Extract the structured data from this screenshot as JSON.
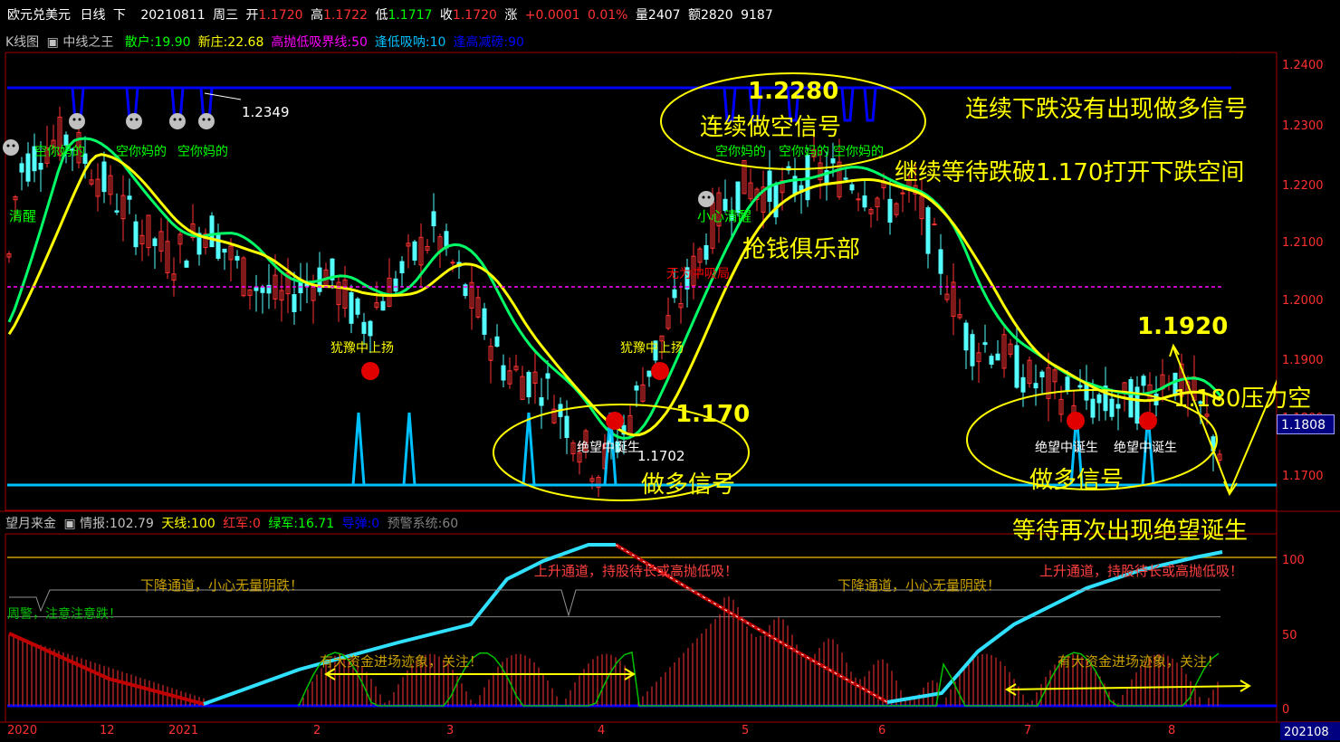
{
  "header": {
    "symbol": "欧元兑美元",
    "period": "日线",
    "dir": "下",
    "date": "20210811",
    "weekday": "周三",
    "open_label": "开",
    "open": "1.1720",
    "high_label": "高",
    "high": "1.1722",
    "low_label": "低",
    "low": "1.1717",
    "close_label": "收",
    "close": "1.1720",
    "change_label": "涨",
    "change": "+0.0001",
    "change_pct": "0.01%",
    "volume_label": "量",
    "volume": "2407",
    "amount_label": "额",
    "amount": "2820",
    "extra": "9187"
  },
  "main_panel": {
    "tab": "K线图",
    "indicator": "中线之王",
    "params": [
      {
        "label": "散户:",
        "value": "19.90",
        "color": "#00ff00"
      },
      {
        "label": "新庄:",
        "value": "22.68",
        "color": "#ffff00"
      },
      {
        "label": "高抛低吸界线:",
        "value": "50",
        "color": "#ff00ff"
      },
      {
        "label": "逢低吸呐:",
        "value": "10",
        "color": "#00c0ff"
      },
      {
        "label": "逢高减磅:",
        "value": "90",
        "color": "#0000ff"
      }
    ]
  },
  "price_axis": {
    "ticks": [
      "1.2400",
      "1.2300",
      "1.2200",
      "1.2100",
      "1.2000",
      "1.1900",
      "1.1800",
      "1.1700"
    ],
    "current": "1.1808"
  },
  "chart_labels": {
    "peak_value": "1.2349",
    "low_value": "1.1702",
    "kong_signal": "空你妈的",
    "qingxing": "清醒",
    "xiaoxin": "小心清醒",
    "wuwei": "无为中吸局",
    "youyu1": "犹豫中上扬",
    "youyu2": "犹豫中上扬",
    "juewang1": "绝望中诞生",
    "juewang2": "绝望中诞生",
    "juewang3": "绝望中诞生"
  },
  "annotations": {
    "peak_price": "1.2280",
    "peak_text": "连续做空信号",
    "top_right": "连续下跌没有出现做多信号",
    "wait_break": "继续等待跌破1.170打开下跌空间",
    "club": "抢钱俱乐部",
    "price_1170": "1.170",
    "long_signal_1": "做多信号",
    "price_1192": "1.1920",
    "pressure": "1.180压力空",
    "long_signal_2": "做多信号",
    "wait_again": "等待再次出现绝望诞生"
  },
  "sub_panel": {
    "name": "望月来金",
    "info_label": "情报:",
    "info": "102.79",
    "tianxian_label": "天线:",
    "tianxian": "100",
    "hongjun_label": "红军:",
    "hongjun": "0",
    "lvjun_label": "绿军:",
    "lvjun": "16.71",
    "daodan_label": "导弹:",
    "daodan": "0",
    "yujing_label": "预警系统:",
    "yujing": "60",
    "ticks": [
      "100",
      "50",
      "0"
    ],
    "down_channel": "下降通道，小心无量阴跌！",
    "up_channel": "上升通道，持股待长或高抛低吸！",
    "funds": "有大资金进场迹象，关注！",
    "warning": "周警，注意注意跌！"
  },
  "x_axis": [
    "2020",
    "12",
    "2021",
    "2",
    "3",
    "4",
    "5",
    "6",
    "7",
    "8"
  ],
  "x_axis_end": "202108",
  "colors": {
    "up": "#ff3232",
    "down": "#54ffff",
    "yellow": "#ffff00",
    "blue": "#0000ff",
    "cyan": "#00c0ff",
    "axis": "#a00000"
  }
}
